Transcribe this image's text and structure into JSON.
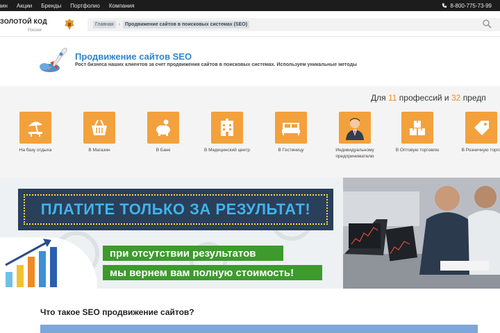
{
  "topnav": {
    "links": [
      "азин",
      "Акции",
      "Бренды",
      "Портфолио",
      "Компания"
    ],
    "phone": "8-800-775-73-99"
  },
  "header": {
    "logo": "ЗОЛОТОЙ КОД",
    "logo_sub": "Россия",
    "breadcrumb_home": "Главная",
    "breadcrumb_sep": "›",
    "breadcrumb_current": "Продвижение сайтов в поисковых системах (SEO)"
  },
  "hero": {
    "title": "Продвижение сайтов SEO",
    "subtitle": "Рост бизнеса наших клиентов за счет продвижения сайтов в поисковых системах. Используем уникальные методы"
  },
  "professions": {
    "head_prefix": "Для",
    "count_prof": "11",
    "head_middle": "профессий и",
    "count_other": "32",
    "head_suffix": "предп",
    "items": [
      {
        "label": "На базу отдыха",
        "icon": "beach-icon"
      },
      {
        "label": "В Магазин",
        "icon": "basket-icon"
      },
      {
        "label": "В Банк",
        "icon": "piggybank-icon"
      },
      {
        "label": "В Медицинский центр",
        "icon": "building-icon"
      },
      {
        "label": "В Гостиницу",
        "icon": "bed-icon"
      },
      {
        "label": "Индивидуальному предпринимателю",
        "icon": "businessman-icon"
      },
      {
        "label": "В Оптовую торговлю",
        "icon": "boxes-icon"
      },
      {
        "label": "В Розничную торго",
        "icon": "tag-icon"
      }
    ]
  },
  "banner": {
    "headline": "ПЛАТИТЕ ТОЛЬКО ЗА РЕЗУЛЬТАТ!",
    "line1": "при отсутствии результатов",
    "line2": "мы вернем вам полную стоимость!"
  },
  "section": {
    "title": "Что такое SEO продвижение сайтов?"
  },
  "colors": {
    "accent_orange": "#f3a13c",
    "link_blue": "#2e86c9",
    "banner_navy": "#2a3f5a",
    "banner_green": "#3c9b2c"
  }
}
